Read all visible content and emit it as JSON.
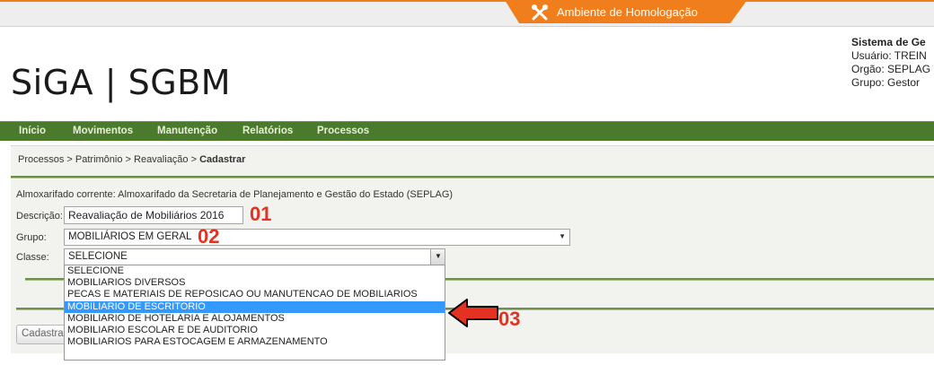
{
  "environment": {
    "label": "Ambiente de Homologação",
    "icon": "tools-icon",
    "tab_color": "#f07e1c"
  },
  "logo": {
    "text": "SiGA | SGBM"
  },
  "system_info": {
    "title": "Sistema de Ge",
    "user": "Usuário: TREIN",
    "org": "Orgão: SEPLAG",
    "group": "Grupo: Gestor"
  },
  "nav": {
    "items": [
      "Início",
      "Movimentos",
      "Manutenção",
      "Relatórios",
      "Processos"
    ],
    "color": "#4a7a2c"
  },
  "breadcrumb": {
    "path": "Processos  > Patrimônio  >  Reavaliação  >",
    "current": "Cadastrar"
  },
  "form": {
    "almoxarifado": "Almoxarifado corrente: Almoxarifado da Secretaria de Planejamento e Gestão do Estado (SEPLAG)",
    "descricao_label": "Descrição:",
    "descricao_value": "Reavaliação de Mobiliários 2016",
    "grupo_label": "Grupo:",
    "grupo_value": "MOBILIÁRIOS EM GERAL",
    "classe_label": "Classe:",
    "classe_value": "SELECIONE",
    "classe_options": [
      "SELECIONE",
      "MOBILIARIOS DIVERSOS",
      "PECAS E MATERIAIS DE REPOSICAO OU MANUTENCAO DE MOBILIARIOS",
      "MOBILIARIO DE ESCRITORIO",
      "MOBILIARIO DE HOTELARIA E ALOJAMENTOS",
      "MOBILIARIO ESCOLAR E DE AUDITORIO",
      "MOBILIARIOS PARA ESTOCAGEM E ARMAZENAMENTO"
    ],
    "highlighted_option": "MOBILIARIO DE ESCRITORIO",
    "submit_label": "Cadastrar"
  },
  "annotations": {
    "a1": "01",
    "a2": "02",
    "a3": "03",
    "color": "#e53121"
  }
}
